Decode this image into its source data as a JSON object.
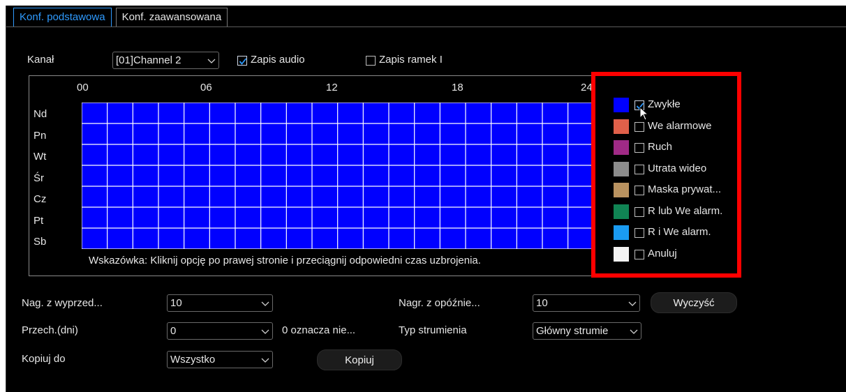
{
  "tabs": [
    {
      "label": "Konf. podstawowa",
      "active": true
    },
    {
      "label": "Konf. zaawansowana",
      "active": false
    }
  ],
  "channel": {
    "label": "Kanał",
    "value": "[01]Channel 2"
  },
  "audio": {
    "label": "Zapis audio",
    "checked": true
  },
  "iframe": {
    "label": "Zapis ramek I",
    "checked": false
  },
  "schedule": {
    "hours": [
      "00",
      "06",
      "12",
      "18",
      "24"
    ],
    "days": [
      "Nd",
      "Pn",
      "Wt",
      "Śr",
      "Cz",
      "Pt",
      "Sb"
    ],
    "grid_color": "#0000ff",
    "columns": 24,
    "hint": "Wskazówka: Kliknij opcję po prawej stronie i przeciągnij odpowiedni czas uzbrojenia."
  },
  "legend": [
    {
      "label": "Zwykłe",
      "color": "#0000ff",
      "checked": true
    },
    {
      "label": "We alarmowe",
      "color": "#e0604a",
      "checked": false
    },
    {
      "label": "Ruch",
      "color": "#a02a86",
      "checked": false
    },
    {
      "label": "Utrata wideo",
      "color": "#8c8c8c",
      "checked": false
    },
    {
      "label": "Maska prywat...",
      "color": "#b99260",
      "checked": false
    },
    {
      "label": "R lub We alarm.",
      "color": "#108454",
      "checked": false
    },
    {
      "label": "R i We alarm.",
      "color": "#1a9bf2",
      "checked": false
    },
    {
      "label": "Anuluj",
      "color": "#f3f3f3",
      "checked": false
    }
  ],
  "form": {
    "prerecord": {
      "label": "Nag. z wyprzed...",
      "value": "10"
    },
    "postrecord": {
      "label": "Nagr. z opóźnie...",
      "value": "10"
    },
    "clear_button": "Wyczyść",
    "storage": {
      "label": "Przech.(dni)",
      "value": "0",
      "note": "0 oznacza nie..."
    },
    "stream": {
      "label": "Typ strumienia",
      "value": "Główny strumie"
    },
    "copy_to": {
      "label": "Kopiuj do",
      "value": "Wszystko"
    },
    "copy_button": "Kopiuj"
  },
  "accent_color": "#2f9bff",
  "highlight_color": "#ff0000"
}
